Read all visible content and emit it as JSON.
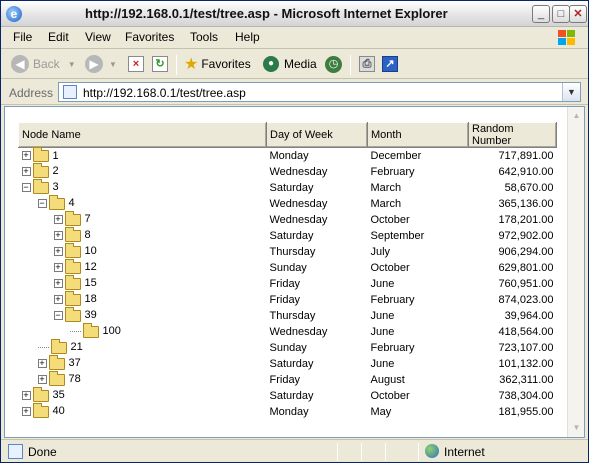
{
  "window": {
    "title": "http://192.168.0.1/test/tree.asp - Microsoft Internet Explorer"
  },
  "menu": [
    "File",
    "Edit",
    "View",
    "Favorites",
    "Tools",
    "Help"
  ],
  "toolbar": {
    "back_label": "Back",
    "favorites_label": "Favorites",
    "media_label": "Media"
  },
  "address": {
    "label": "Address",
    "url": "http://192.168.0.1/test/tree.asp"
  },
  "grid": {
    "columns": [
      "Node Name",
      "Day of Week",
      "Month",
      "Random Number"
    ],
    "rows": [
      {
        "name": "1",
        "depth": 0,
        "expander": "+",
        "day": "Monday",
        "month": "December",
        "number": "717,891.00"
      },
      {
        "name": "2",
        "depth": 0,
        "expander": "+",
        "day": "Wednesday",
        "month": "February",
        "number": "642,910.00"
      },
      {
        "name": "3",
        "depth": 0,
        "expander": "-",
        "day": "Saturday",
        "month": "March",
        "number": "58,670.00"
      },
      {
        "name": "4",
        "depth": 1,
        "expander": "-",
        "day": "Wednesday",
        "month": "March",
        "number": "365,136.00"
      },
      {
        "name": "7",
        "depth": 2,
        "expander": "+",
        "day": "Wednesday",
        "month": "October",
        "number": "178,201.00"
      },
      {
        "name": "8",
        "depth": 2,
        "expander": "+",
        "day": "Saturday",
        "month": "September",
        "number": "972,902.00"
      },
      {
        "name": "10",
        "depth": 2,
        "expander": "+",
        "day": "Thursday",
        "month": "July",
        "number": "906,294.00"
      },
      {
        "name": "12",
        "depth": 2,
        "expander": "+",
        "day": "Sunday",
        "month": "October",
        "number": "629,801.00"
      },
      {
        "name": "15",
        "depth": 2,
        "expander": "+",
        "day": "Friday",
        "month": "June",
        "number": "760,951.00"
      },
      {
        "name": "18",
        "depth": 2,
        "expander": "+",
        "day": "Friday",
        "month": "February",
        "number": "874,023.00"
      },
      {
        "name": "39",
        "depth": 2,
        "expander": "-",
        "day": "Thursday",
        "month": "June",
        "number": "39,964.00"
      },
      {
        "name": "100",
        "depth": 3,
        "expander": "",
        "day": "Wednesday",
        "month": "June",
        "number": "418,564.00"
      },
      {
        "name": "21",
        "depth": 1,
        "expander": "",
        "day": "Sunday",
        "month": "February",
        "number": "723,107.00"
      },
      {
        "name": "37",
        "depth": 1,
        "expander": "+",
        "day": "Saturday",
        "month": "June",
        "number": "101,132.00"
      },
      {
        "name": "78",
        "depth": 1,
        "expander": "+",
        "day": "Friday",
        "month": "August",
        "number": "362,311.00"
      },
      {
        "name": "35",
        "depth": 0,
        "expander": "+",
        "day": "Saturday",
        "month": "October",
        "number": "738,304.00"
      },
      {
        "name": "40",
        "depth": 0,
        "expander": "+",
        "day": "Monday",
        "month": "May",
        "number": "181,955.00"
      }
    ]
  },
  "status": {
    "text": "Done",
    "zone": "Internet"
  },
  "colors": {
    "title_bar": "#e7e7e7",
    "chrome": "#ece9d8",
    "folder": "#f5dc7a",
    "border_blue": "#7f9db9"
  },
  "icons": [
    "ie-icon",
    "back-icon",
    "forward-icon",
    "stop-icon",
    "refresh-icon",
    "favorites-star-icon",
    "media-icon",
    "history-icon",
    "print-icon",
    "edit-icon",
    "page-icon",
    "folder-icon",
    "internet-zone-icon",
    "windows-logo-icon"
  ]
}
